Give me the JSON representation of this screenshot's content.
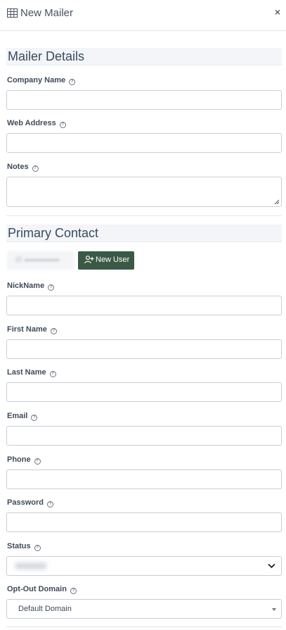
{
  "header": {
    "title": "New Mailer",
    "close_glyph": "×",
    "icon": "table-icon"
  },
  "mailer_details": {
    "heading": "Mailer Details",
    "company_name": {
      "label": "Company Name",
      "value": ""
    },
    "web_address": {
      "label": "Web Address",
      "value": ""
    },
    "notes": {
      "label": "Notes",
      "value": ""
    }
  },
  "primary_contact": {
    "heading": "Primary Contact",
    "new_user_label": "New User",
    "nickname": {
      "label": "NickName",
      "value": ""
    },
    "first_name": {
      "label": "First Name",
      "value": ""
    },
    "last_name": {
      "label": "Last Name",
      "value": ""
    },
    "email": {
      "label": "Email",
      "value": ""
    },
    "phone": {
      "label": "Phone",
      "value": ""
    },
    "password": {
      "label": "Password",
      "value": ""
    },
    "status": {
      "label": "Status"
    },
    "opt_out_domain": {
      "label": "Opt-Out Domain",
      "value": "Default Domain"
    }
  },
  "help_glyph": "?",
  "colors": {
    "new_user_bg": "#3b5a45",
    "section_bg": "#f3f5f8",
    "border": "#c9ced6"
  }
}
